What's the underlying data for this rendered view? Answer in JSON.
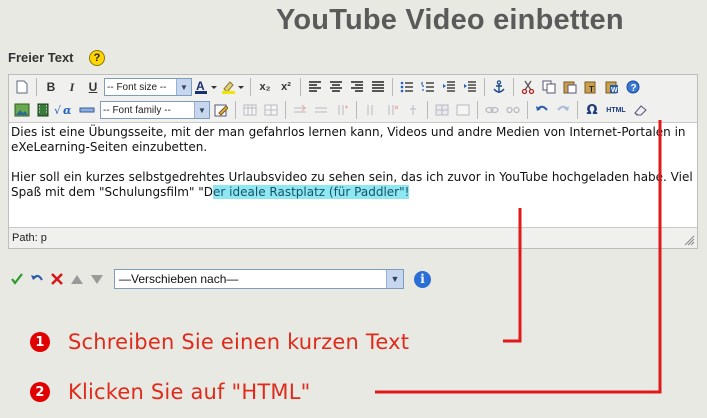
{
  "page": {
    "title": "YouTube Video einbetten"
  },
  "field": {
    "label": "Freier Text",
    "help_glyph": "?"
  },
  "toolbar": {
    "font_size_select": "-- Font size --",
    "font_family_select": "-- Font family --",
    "html_button_label": "HTML",
    "icons_row1": [
      "new-document-icon",
      "bold-icon",
      "italic-icon",
      "underline-icon",
      "font-size-select",
      "text-color-icon",
      "highlight-color-icon",
      "subscript-icon",
      "superscript-icon",
      "align-left-icon",
      "align-center-icon",
      "align-right-icon",
      "align-justify-icon",
      "bullet-list-icon",
      "numbered-list-icon",
      "outdent-icon",
      "indent-icon",
      "anchor-icon",
      "cut-icon",
      "copy-icon",
      "paste-icon",
      "paste-text-icon",
      "paste-word-icon",
      "help-icon"
    ],
    "icons_row2": [
      "insert-image-icon",
      "insert-media-icon",
      "insert-math-icon",
      "horizontal-rule-icon",
      "font-family-select",
      "edit-icon",
      "table-icon",
      "table-props-icon",
      "row-insert-icon",
      "row-delete-icon",
      "col-insert-icon",
      "col-delete-icon",
      "col-split-icon",
      "cell-merge-icon",
      "link-icon",
      "unlink-icon",
      "undo-icon",
      "redo-icon",
      "special-char-icon",
      "html-button",
      "eraser-icon"
    ],
    "labels": {
      "bold": "B",
      "italic": "I",
      "underline": "U",
      "subscript": "x₂",
      "superscript": "x²",
      "special_char": "Ω"
    }
  },
  "editor": {
    "paragraph1": "Dies ist eine Übungsseite, mit der man gefahrlos lernen kann, Videos und andre Medien von Internet-Portalen in eXeLearning-Seiten einzubetten.",
    "paragraph2_before": "Hier soll ein kurzes selbstgedrehtes Urlaubsvideo zu sehen sein, das ich zuvor in YouTube hochgeladen habe. Viel Spaß mit dem \"Schulungsfilm\" \"D",
    "paragraph2_highlight": "er ideale Rastplatz (für Paddler\"!",
    "status_path": "Path: p"
  },
  "actions": {
    "move_select": "—Verschieben nach—",
    "info_glyph": "i"
  },
  "steps": [
    {
      "number": "1",
      "text": "Schreiben Sie einen kurzen Text"
    },
    {
      "number": "2",
      "text": "Klicken Sie auf \"HTML\""
    }
  ],
  "colors": {
    "background": "#e9e9e4",
    "title": "#5a5a5a",
    "annotation_red": "#e02a1a",
    "highlight": "#8ee8f2"
  }
}
